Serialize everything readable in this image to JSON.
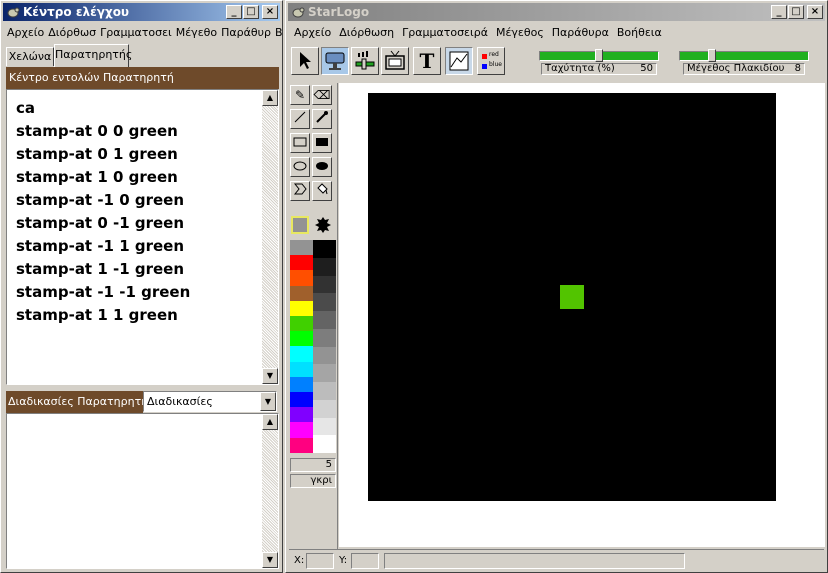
{
  "control": {
    "title": "Κέντρο ελέγχου",
    "menu": [
      "Αρχείο",
      "Διόρθωσ",
      "Γραμματοσει",
      "Μέγεθο",
      "Παράθυρ",
      "Βοήθεια"
    ],
    "tabs": [
      "Χελώνα",
      "Παρατηρητής"
    ],
    "command_center_label": "Κέντρο εντολών Παρατηρητή",
    "commands": [
      "ca",
      "stamp-at 0 0 green",
      "stamp-at 0 1 green",
      "stamp-at 1 0 green",
      "stamp-at -1 0 green",
      "stamp-at 0 -1 green",
      "stamp-at -1 1 green",
      "stamp-at 1 -1 green",
      "stamp-at -1 -1 green",
      "stamp-at 1 1 green"
    ],
    "procedures_label": "Διαδικασίες Παρατηρητή",
    "procedures_select": "Διαδικασίες"
  },
  "starlogo": {
    "title": "StarLogo",
    "menu": [
      "Αρχείο",
      "Διόρθωση",
      "Γραμματοσειρά",
      "Μέγεθος",
      "Παράθυρα",
      "Βοήθεια"
    ],
    "speed_label": "Ταχύτητα (%)",
    "speed_value": "50",
    "patch_label": "Μέγεθος Πλακιδίου",
    "patch_value": "8",
    "color_legend": [
      "red",
      "blue"
    ],
    "pen_size": "5",
    "color_name": "γκρι",
    "status_x_label": "X:",
    "status_y_label": "Y:"
  },
  "palette": {
    "left": [
      "#939393",
      "#ff0000",
      "#ff4f00",
      "#a0602c",
      "#ffff00",
      "#40d000",
      "#00ff00",
      "#00ffff",
      "#00e0ff",
      "#0080ff",
      "#0000ff",
      "#8000ff",
      "#ff00ff",
      "#ff0080"
    ],
    "right": [
      "#000000",
      "#1e1e1e",
      "#323232",
      "#4b4b4b",
      "#646464",
      "#7d7d7d",
      "#939393",
      "#a5a5a5",
      "#bcbcbc",
      "#d2d2d2",
      "#e6e6e6",
      "#ffffff"
    ]
  },
  "colors": {
    "title_active": "#0a246a",
    "panel_brown": "#6e4a2a",
    "stamp_green": "#52c400",
    "canvas": "#000000"
  }
}
